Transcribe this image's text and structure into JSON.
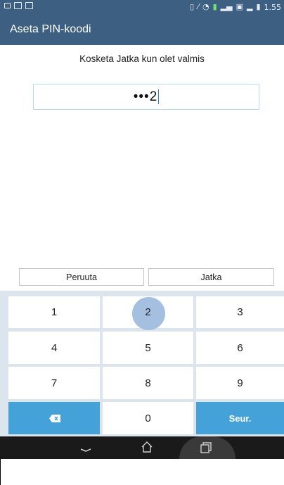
{
  "status_bar": {
    "time": "1.55"
  },
  "app_bar": {
    "title": "Aseta PIN-koodi"
  },
  "content": {
    "prompt": "Kosketa Jatka kun olet valmis",
    "pin_value": "•••2"
  },
  "actions": {
    "cancel_label": "Peruuta",
    "continue_label": "Jatka"
  },
  "keypad": {
    "keys": [
      "1",
      "2",
      "3",
      "4",
      "5",
      "6",
      "7",
      "8",
      "9",
      "0"
    ],
    "next_label": "Seur.",
    "pressed_key": "2",
    "accent_color": "#44a2d9"
  },
  "nav_bar": {
    "icons": [
      "back-icon",
      "home-icon",
      "recents-icon"
    ]
  }
}
